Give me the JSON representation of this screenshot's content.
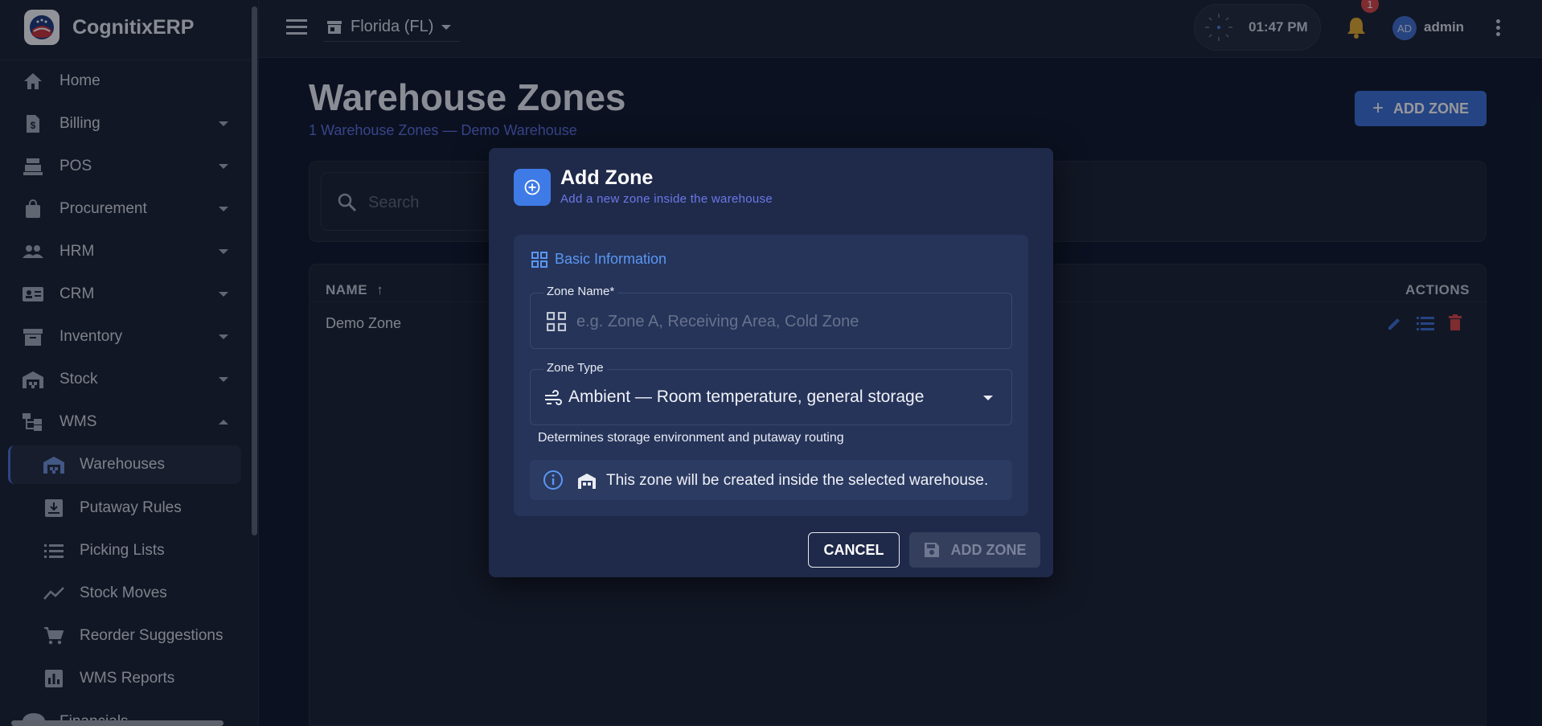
{
  "app": {
    "name": "CognitixERP"
  },
  "topbar": {
    "store": "Florida (FL)",
    "time": "01:47 PM",
    "notification_count": "1",
    "user_initials": "AD",
    "user_name": "admin"
  },
  "sidebar": {
    "items": [
      {
        "label": "Home"
      },
      {
        "label": "Billing"
      },
      {
        "label": "POS"
      },
      {
        "label": "Procurement"
      },
      {
        "label": "HRM"
      },
      {
        "label": "CRM"
      },
      {
        "label": "Inventory"
      },
      {
        "label": "Stock"
      },
      {
        "label": "WMS"
      }
    ],
    "wms_items": [
      {
        "label": "Warehouses"
      },
      {
        "label": "Putaway Rules"
      },
      {
        "label": "Picking Lists"
      },
      {
        "label": "Stock Moves"
      },
      {
        "label": "Reorder Suggestions"
      },
      {
        "label": "WMS Reports"
      }
    ],
    "cut_item": "Financials"
  },
  "page": {
    "title": "Warehouse Zones",
    "subtitle": "1 Warehouse Zones — Demo Warehouse",
    "add_button": "ADD ZONE",
    "search_placeholder": "Search"
  },
  "table": {
    "headers": {
      "name": "NAME",
      "actions": "ACTIONS"
    },
    "rows": [
      {
        "name": "Demo Zone"
      }
    ]
  },
  "modal": {
    "title": "Add Zone",
    "subtitle": "Add a new zone inside the warehouse",
    "section": "Basic Information",
    "zone_name_label": "Zone Name*",
    "zone_name_placeholder": "e.g. Zone A, Receiving Area, Cold Zone",
    "zone_type_label": "Zone Type",
    "zone_type_value": "Ambient — Room temperature, general storage",
    "zone_type_hint": "Determines storage environment and putaway routing",
    "info_text": "This zone will be created inside the selected warehouse.",
    "cancel": "CANCEL",
    "submit": "ADD ZONE"
  },
  "colors": {
    "accent": "#3b6fd4",
    "danger": "#d64545",
    "notification": "#e0a82e"
  }
}
